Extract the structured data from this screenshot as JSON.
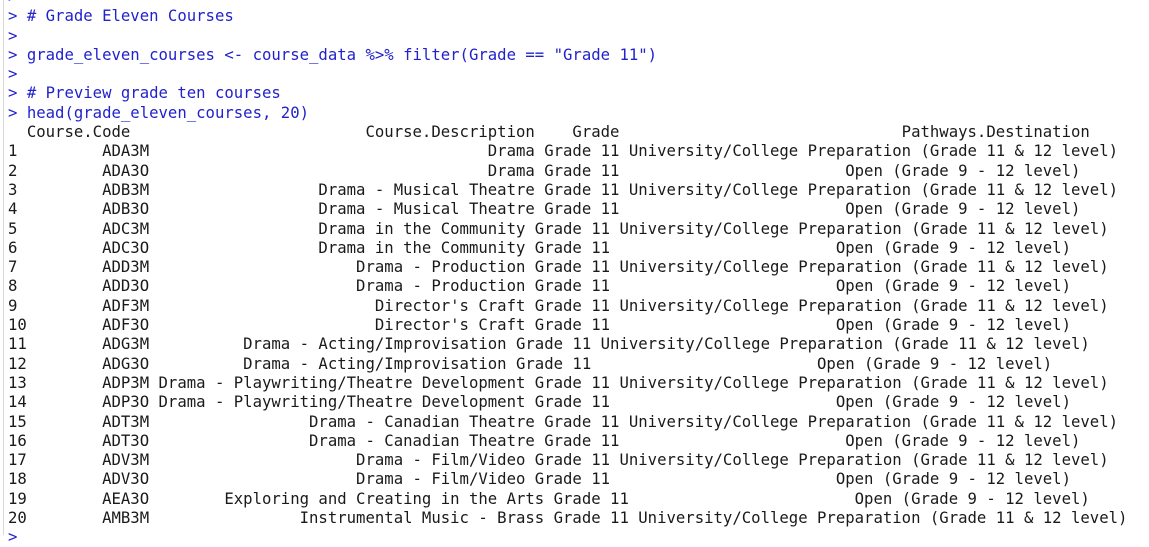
{
  "app": {
    "name": "r-console",
    "title": "R Console",
    "prompt": ">",
    "colors": {
      "background": "#ffffff",
      "input_text": "#2222cc",
      "output_text": "#1a1a1a",
      "gutter_rule": "#d8d8d8"
    }
  },
  "console": {
    "lines": [
      {
        "kind": "prompt-only",
        "text": ">"
      },
      {
        "kind": "input",
        "text": "> # Grade Eleven Courses"
      },
      {
        "kind": "prompt-only",
        "text": ">"
      },
      {
        "kind": "input",
        "text": "> grade_eleven_courses <- course_data %>% filter(Grade == \"Grade 11\")"
      },
      {
        "kind": "prompt-only",
        "text": ">"
      },
      {
        "kind": "input",
        "text": "> # Preview grade ten courses"
      },
      {
        "kind": "input",
        "text": "> head(grade_eleven_courses, 20)"
      },
      {
        "kind": "output",
        "text": "  Course.Code                         Course.Description    Grade                              Pathways.Destination"
      },
      {
        "kind": "output",
        "text": "1         ADA3M                                    Drama Grade 11 University/College Preparation (Grade 11 & 12 level)"
      },
      {
        "kind": "output",
        "text": "2         ADA3O                                    Drama Grade 11                        Open (Grade 9 - 12 level)"
      },
      {
        "kind": "output",
        "text": "3         ADB3M                  Drama - Musical Theatre Grade 11 University/College Preparation (Grade 11 & 12 level)"
      },
      {
        "kind": "output",
        "text": "4         ADB3O                  Drama - Musical Theatre Grade 11                        Open (Grade 9 - 12 level)"
      },
      {
        "kind": "output",
        "text": "5         ADC3M                  Drama in the Community Grade 11 University/College Preparation (Grade 11 & 12 level)"
      },
      {
        "kind": "output",
        "text": "6         ADC3O                  Drama in the Community Grade 11                        Open (Grade 9 - 12 level)"
      },
      {
        "kind": "output",
        "text": "7         ADD3M                      Drama - Production Grade 11 University/College Preparation (Grade 11 & 12 level)"
      },
      {
        "kind": "output",
        "text": "8         ADD3O                      Drama - Production Grade 11                        Open (Grade 9 - 12 level)"
      },
      {
        "kind": "output",
        "text": "9         ADF3M                        Director's Craft Grade 11 University/College Preparation (Grade 11 & 12 level)"
      },
      {
        "kind": "output",
        "text": "10        ADF3O                        Director's Craft Grade 11                        Open (Grade 9 - 12 level)"
      },
      {
        "kind": "output",
        "text": "11        ADG3M          Drama - Acting/Improvisation Grade 11 University/College Preparation (Grade 11 & 12 level)"
      },
      {
        "kind": "output",
        "text": "12        ADG3O          Drama - Acting/Improvisation Grade 11                        Open (Grade 9 - 12 level)"
      },
      {
        "kind": "output",
        "text": "13        ADP3M Drama - Playwriting/Theatre Development Grade 11 University/College Preparation (Grade 11 & 12 level)"
      },
      {
        "kind": "output",
        "text": "14        ADP3O Drama - Playwriting/Theatre Development Grade 11                        Open (Grade 9 - 12 level)"
      },
      {
        "kind": "output",
        "text": "15        ADT3M                 Drama - Canadian Theatre Grade 11 University/College Preparation (Grade 11 & 12 level)"
      },
      {
        "kind": "output",
        "text": "16        ADT3O                 Drama - Canadian Theatre Grade 11                        Open (Grade 9 - 12 level)"
      },
      {
        "kind": "output",
        "text": "17        ADV3M                      Drama - Film/Video Grade 11 University/College Preparation (Grade 11 & 12 level)"
      },
      {
        "kind": "output",
        "text": "18        ADV3O                      Drama - Film/Video Grade 11                        Open (Grade 9 - 12 level)"
      },
      {
        "kind": "output",
        "text": "19        AEA3O        Exploring and Creating in the Arts Grade 11                        Open (Grade 9 - 12 level)"
      },
      {
        "kind": "output",
        "text": "20        AMB3M                Instrumental Music - Brass Grade 11 University/College Preparation (Grade 11 & 12 level)"
      },
      {
        "kind": "prompt-only",
        "text": ">"
      }
    ],
    "table": {
      "columns": [
        "",
        "Course.Code",
        "Course.Description",
        "Grade",
        "Pathways.Destination"
      ],
      "rows": [
        {
          "n": "1",
          "code": "ADA3M",
          "description": "Drama",
          "grade": "Grade 11",
          "pathway": "University/College Preparation (Grade 11 & 12 level)"
        },
        {
          "n": "2",
          "code": "ADA3O",
          "description": "Drama",
          "grade": "Grade 11",
          "pathway": "Open (Grade 9 - 12 level)"
        },
        {
          "n": "3",
          "code": "ADB3M",
          "description": "Drama - Musical Theatre",
          "grade": "Grade 11",
          "pathway": "University/College Preparation (Grade 11 & 12 level)"
        },
        {
          "n": "4",
          "code": "ADB3O",
          "description": "Drama - Musical Theatre",
          "grade": "Grade 11",
          "pathway": "Open (Grade 9 - 12 level)"
        },
        {
          "n": "5",
          "code": "ADC3M",
          "description": "Drama in the Community",
          "grade": "Grade 11",
          "pathway": "University/College Preparation (Grade 11 & 12 level)"
        },
        {
          "n": "6",
          "code": "ADC3O",
          "description": "Drama in the Community",
          "grade": "Grade 11",
          "pathway": "Open (Grade 9 - 12 level)"
        },
        {
          "n": "7",
          "code": "ADD3M",
          "description": "Drama - Production",
          "grade": "Grade 11",
          "pathway": "University/College Preparation (Grade 11 & 12 level)"
        },
        {
          "n": "8",
          "code": "ADD3O",
          "description": "Drama - Production",
          "grade": "Grade 11",
          "pathway": "Open (Grade 9 - 12 level)"
        },
        {
          "n": "9",
          "code": "ADF3M",
          "description": "Director's Craft",
          "grade": "Grade 11",
          "pathway": "University/College Preparation (Grade 11 & 12 level)"
        },
        {
          "n": "10",
          "code": "ADF3O",
          "description": "Director's Craft",
          "grade": "Grade 11",
          "pathway": "Open (Grade 9 - 12 level)"
        },
        {
          "n": "11",
          "code": "ADG3M",
          "description": "Drama - Acting/Improvisation",
          "grade": "Grade 11",
          "pathway": "University/College Preparation (Grade 11 & 12 level)"
        },
        {
          "n": "12",
          "code": "ADG3O",
          "description": "Drama - Acting/Improvisation",
          "grade": "Grade 11",
          "pathway": "Open (Grade 9 - 12 level)"
        },
        {
          "n": "13",
          "code": "ADP3M",
          "description": "Drama - Playwriting/Theatre Development",
          "grade": "Grade 11",
          "pathway": "University/College Preparation (Grade 11 & 12 level)"
        },
        {
          "n": "14",
          "code": "ADP3O",
          "description": "Drama - Playwriting/Theatre Development",
          "grade": "Grade 11",
          "pathway": "Open (Grade 9 - 12 level)"
        },
        {
          "n": "15",
          "code": "ADT3M",
          "description": "Drama - Canadian Theatre",
          "grade": "Grade 11",
          "pathway": "University/College Preparation (Grade 11 & 12 level)"
        },
        {
          "n": "16",
          "code": "ADT3O",
          "description": "Drama - Canadian Theatre",
          "grade": "Grade 11",
          "pathway": "Open (Grade 9 - 12 level)"
        },
        {
          "n": "17",
          "code": "ADV3M",
          "description": "Drama - Film/Video",
          "grade": "Grade 11",
          "pathway": "University/College Preparation (Grade 11 & 12 level)"
        },
        {
          "n": "18",
          "code": "ADV3O",
          "description": "Drama - Film/Video",
          "grade": "Grade 11",
          "pathway": "Open (Grade 9 - 12 level)"
        },
        {
          "n": "19",
          "code": "AEA3O",
          "description": "Exploring and Creating in the Arts",
          "grade": "Grade 11",
          "pathway": "Open (Grade 9 - 12 level)"
        },
        {
          "n": "20",
          "code": "AMB3M",
          "description": "Instrumental Music - Brass",
          "grade": "Grade 11",
          "pathway": "University/College Preparation (Grade 11 & 12 level)"
        }
      ]
    }
  }
}
